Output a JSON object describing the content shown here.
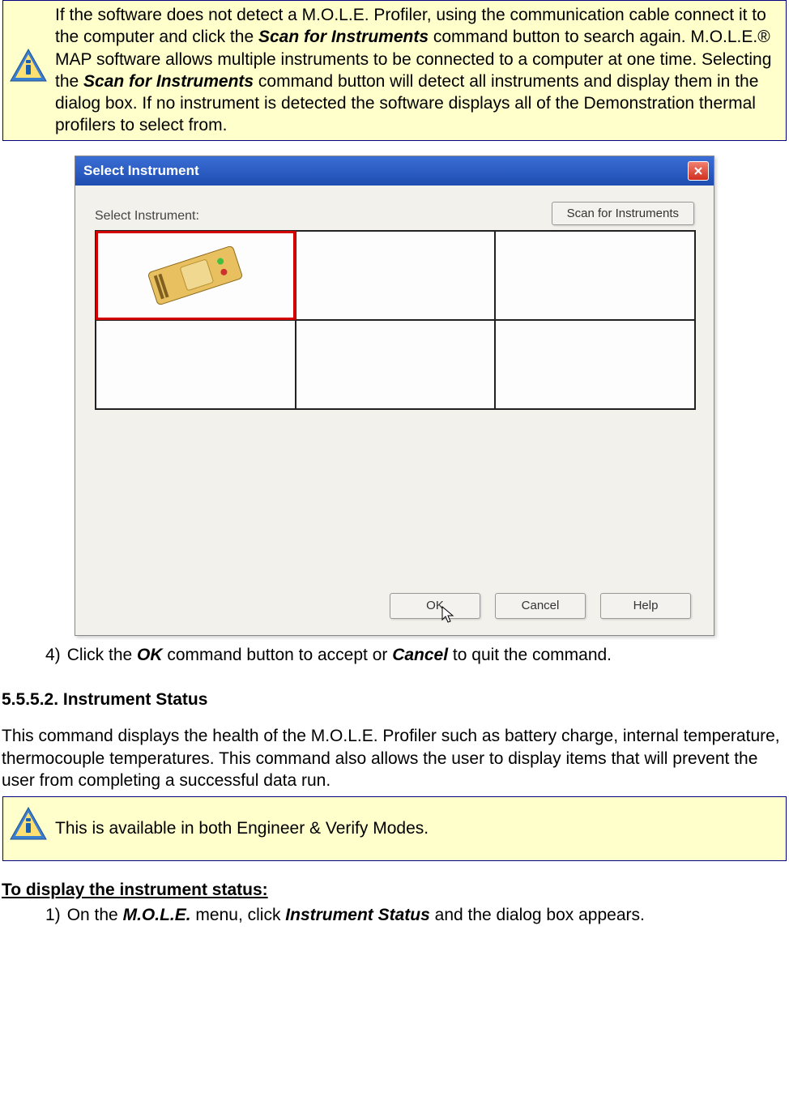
{
  "note1": {
    "t1": "If the software does not detect a M.O.L.E. Profiler, using the communication cable connect it to the computer and click the ",
    "b1": "Scan for Instruments",
    "t2": " command button to search again. M.O.L.E.® MAP software allows multiple instruments to be connected to a computer at one time. Selecting the ",
    "b2": "Scan for Instruments",
    "t3": " command button will detect all instruments and display them in the dialog box. If no instrument is detected the software displays all of the Demonstration thermal profilers to select from."
  },
  "dialog": {
    "title": "Select Instrument",
    "close_label": "X",
    "select_label": "Select Instrument:",
    "scan_button": "Scan for Instruments",
    "ok": "OK",
    "cancel": "Cancel",
    "help": "Help"
  },
  "step4": {
    "num": "4)",
    "t1": "Click the ",
    "b1": "OK",
    "t2": " command button to accept or ",
    "b2": "Cancel",
    "t3": " to quit the command."
  },
  "section": "5.5.5.2. Instrument Status",
  "para": "This command displays the health of the M.O.L.E. Profiler such as battery charge, internal temperature, thermocouple temperatures. This command also allows the user to display items that will prevent the user from completing a successful data run.",
  "note2": "This is available in both Engineer & Verify Modes.",
  "procedure_head": "To display the instrument status:",
  "step1": {
    "num": "1)",
    "t1": "On the ",
    "b1": "M.O.L.E.",
    "t2": " menu, click ",
    "b2": "Instrument Status",
    "t3": " and the dialog box appears."
  }
}
